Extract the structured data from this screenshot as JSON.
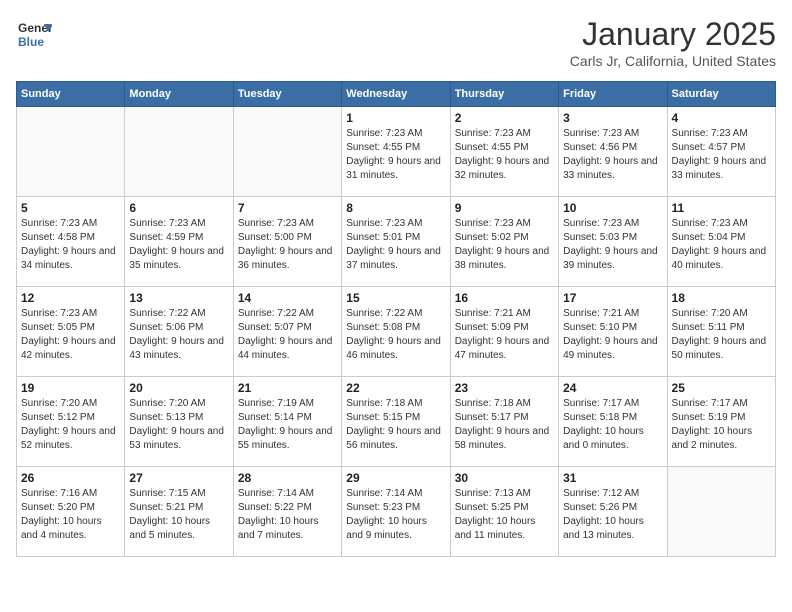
{
  "logo": {
    "line1": "General",
    "line2": "Blue"
  },
  "title": "January 2025",
  "subtitle": "Carls Jr, California, United States",
  "weekdays": [
    "Sunday",
    "Monday",
    "Tuesday",
    "Wednesday",
    "Thursday",
    "Friday",
    "Saturday"
  ],
  "weeks": [
    [
      {
        "day": "",
        "info": ""
      },
      {
        "day": "",
        "info": ""
      },
      {
        "day": "",
        "info": ""
      },
      {
        "day": "1",
        "info": "Sunrise: 7:23 AM\nSunset: 4:55 PM\nDaylight: 9 hours and 31 minutes."
      },
      {
        "day": "2",
        "info": "Sunrise: 7:23 AM\nSunset: 4:55 PM\nDaylight: 9 hours and 32 minutes."
      },
      {
        "day": "3",
        "info": "Sunrise: 7:23 AM\nSunset: 4:56 PM\nDaylight: 9 hours and 33 minutes."
      },
      {
        "day": "4",
        "info": "Sunrise: 7:23 AM\nSunset: 4:57 PM\nDaylight: 9 hours and 33 minutes."
      }
    ],
    [
      {
        "day": "5",
        "info": "Sunrise: 7:23 AM\nSunset: 4:58 PM\nDaylight: 9 hours and 34 minutes."
      },
      {
        "day": "6",
        "info": "Sunrise: 7:23 AM\nSunset: 4:59 PM\nDaylight: 9 hours and 35 minutes."
      },
      {
        "day": "7",
        "info": "Sunrise: 7:23 AM\nSunset: 5:00 PM\nDaylight: 9 hours and 36 minutes."
      },
      {
        "day": "8",
        "info": "Sunrise: 7:23 AM\nSunset: 5:01 PM\nDaylight: 9 hours and 37 minutes."
      },
      {
        "day": "9",
        "info": "Sunrise: 7:23 AM\nSunset: 5:02 PM\nDaylight: 9 hours and 38 minutes."
      },
      {
        "day": "10",
        "info": "Sunrise: 7:23 AM\nSunset: 5:03 PM\nDaylight: 9 hours and 39 minutes."
      },
      {
        "day": "11",
        "info": "Sunrise: 7:23 AM\nSunset: 5:04 PM\nDaylight: 9 hours and 40 minutes."
      }
    ],
    [
      {
        "day": "12",
        "info": "Sunrise: 7:23 AM\nSunset: 5:05 PM\nDaylight: 9 hours and 42 minutes."
      },
      {
        "day": "13",
        "info": "Sunrise: 7:22 AM\nSunset: 5:06 PM\nDaylight: 9 hours and 43 minutes."
      },
      {
        "day": "14",
        "info": "Sunrise: 7:22 AM\nSunset: 5:07 PM\nDaylight: 9 hours and 44 minutes."
      },
      {
        "day": "15",
        "info": "Sunrise: 7:22 AM\nSunset: 5:08 PM\nDaylight: 9 hours and 46 minutes."
      },
      {
        "day": "16",
        "info": "Sunrise: 7:21 AM\nSunset: 5:09 PM\nDaylight: 9 hours and 47 minutes."
      },
      {
        "day": "17",
        "info": "Sunrise: 7:21 AM\nSunset: 5:10 PM\nDaylight: 9 hours and 49 minutes."
      },
      {
        "day": "18",
        "info": "Sunrise: 7:20 AM\nSunset: 5:11 PM\nDaylight: 9 hours and 50 minutes."
      }
    ],
    [
      {
        "day": "19",
        "info": "Sunrise: 7:20 AM\nSunset: 5:12 PM\nDaylight: 9 hours and 52 minutes."
      },
      {
        "day": "20",
        "info": "Sunrise: 7:20 AM\nSunset: 5:13 PM\nDaylight: 9 hours and 53 minutes."
      },
      {
        "day": "21",
        "info": "Sunrise: 7:19 AM\nSunset: 5:14 PM\nDaylight: 9 hours and 55 minutes."
      },
      {
        "day": "22",
        "info": "Sunrise: 7:18 AM\nSunset: 5:15 PM\nDaylight: 9 hours and 56 minutes."
      },
      {
        "day": "23",
        "info": "Sunrise: 7:18 AM\nSunset: 5:17 PM\nDaylight: 9 hours and 58 minutes."
      },
      {
        "day": "24",
        "info": "Sunrise: 7:17 AM\nSunset: 5:18 PM\nDaylight: 10 hours and 0 minutes."
      },
      {
        "day": "25",
        "info": "Sunrise: 7:17 AM\nSunset: 5:19 PM\nDaylight: 10 hours and 2 minutes."
      }
    ],
    [
      {
        "day": "26",
        "info": "Sunrise: 7:16 AM\nSunset: 5:20 PM\nDaylight: 10 hours and 4 minutes."
      },
      {
        "day": "27",
        "info": "Sunrise: 7:15 AM\nSunset: 5:21 PM\nDaylight: 10 hours and 5 minutes."
      },
      {
        "day": "28",
        "info": "Sunrise: 7:14 AM\nSunset: 5:22 PM\nDaylight: 10 hours and 7 minutes."
      },
      {
        "day": "29",
        "info": "Sunrise: 7:14 AM\nSunset: 5:23 PM\nDaylight: 10 hours and 9 minutes."
      },
      {
        "day": "30",
        "info": "Sunrise: 7:13 AM\nSunset: 5:25 PM\nDaylight: 10 hours and 11 minutes."
      },
      {
        "day": "31",
        "info": "Sunrise: 7:12 AM\nSunset: 5:26 PM\nDaylight: 10 hours and 13 minutes."
      },
      {
        "day": "",
        "info": ""
      }
    ]
  ]
}
